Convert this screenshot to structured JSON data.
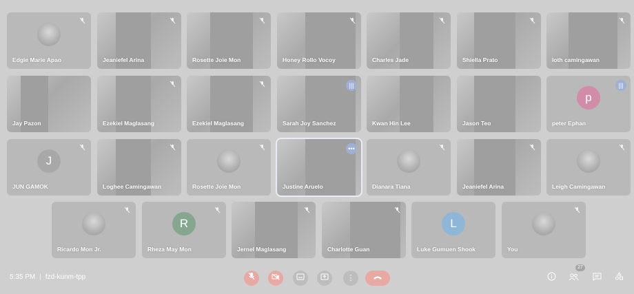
{
  "colors": {
    "stage_bg": "#cfcfcf",
    "tile_bg": "#b9b9b9",
    "avatar_green": "#86a690",
    "avatar_blue": "#8fb6d6",
    "avatar_pink": "#d08ca8",
    "mic_off_red": "#e8a9a3",
    "speaking_blue": "#9fb0d6"
  },
  "participants": [
    [
      {
        "name": "Edgie Marie Apao",
        "type": "photo",
        "muted": true
      },
      {
        "name": "Jeaniefel Arina",
        "type": "video",
        "muted": true
      },
      {
        "name": "Rosette Joie Mon",
        "type": "video",
        "muted": true
      },
      {
        "name": "Honey Rollo Vocoy",
        "type": "video",
        "muted": true
      },
      {
        "name": "Charles Jade",
        "type": "video",
        "muted": true
      },
      {
        "name": "Shiella Prato",
        "type": "video",
        "muted": true
      },
      {
        "name": "loth camingawan",
        "type": "video",
        "muted": true
      }
    ],
    [
      {
        "name": "Jay Pazon",
        "type": "video",
        "muted": false
      },
      {
        "name": "Ezekiel Maglasang",
        "type": "video",
        "muted": true
      },
      {
        "name": "Ezekiel Maglasang",
        "type": "video",
        "muted": true
      },
      {
        "name": "Sarah Joy Sanchez",
        "type": "video",
        "muted": false,
        "speaking": true
      },
      {
        "name": "Kwan Hin Lee",
        "type": "video",
        "muted": false
      },
      {
        "name": "Jason Teo",
        "type": "video",
        "muted": false
      },
      {
        "name": "peter Ephan",
        "type": "initial",
        "initial": "p",
        "avatar_color": "#d08ca8",
        "muted": false,
        "speaking": true
      }
    ],
    [
      {
        "name": "JUN GAMOK",
        "type": "initial",
        "initial": "J",
        "avatar_color": "#a8a8a8",
        "muted": true
      },
      {
        "name": "Loghee Camingawan",
        "type": "video",
        "muted": true
      },
      {
        "name": "Rosette Joie Mon",
        "type": "photo",
        "muted": true
      },
      {
        "name": "Justine Aruelo",
        "type": "video",
        "muted": false,
        "active": true
      },
      {
        "name": "Dianara Tiana",
        "type": "photo",
        "muted": true
      },
      {
        "name": "Jeaniefel Arina",
        "type": "video",
        "muted": true
      },
      {
        "name": "Leigh Camingawan",
        "type": "photo",
        "muted": true
      }
    ],
    [
      {
        "name": "Ricardo Mon Jr.",
        "type": "photo",
        "muted": true
      },
      {
        "name": "Rheza May Mon",
        "type": "initial",
        "initial": "R",
        "avatar_color": "#86a690",
        "muted": true
      },
      {
        "name": "Jernel Maglasang",
        "type": "video",
        "muted": true
      },
      {
        "name": "Charlotte Guan",
        "type": "video",
        "muted": true
      },
      {
        "name": "Luke Gumuen Shook",
        "type": "initial",
        "initial": "L",
        "avatar_color": "#8fb6d6",
        "muted": false
      },
      {
        "name": "You",
        "type": "photo",
        "muted": true
      }
    ]
  ],
  "footer": {
    "time": "5:35 PM",
    "separator": "|",
    "meeting_code": "fzd-kunm-tpp",
    "people_count": "27"
  },
  "icons": {
    "mic_off": "mic-off-icon",
    "cam_off": "camera-off-icon",
    "captions": "captions-icon",
    "present": "present-icon",
    "more": "more-vert-icon",
    "hangup": "hangup-icon",
    "info": "info-icon",
    "people": "people-icon",
    "chat": "chat-icon",
    "activities": "activities-icon"
  }
}
